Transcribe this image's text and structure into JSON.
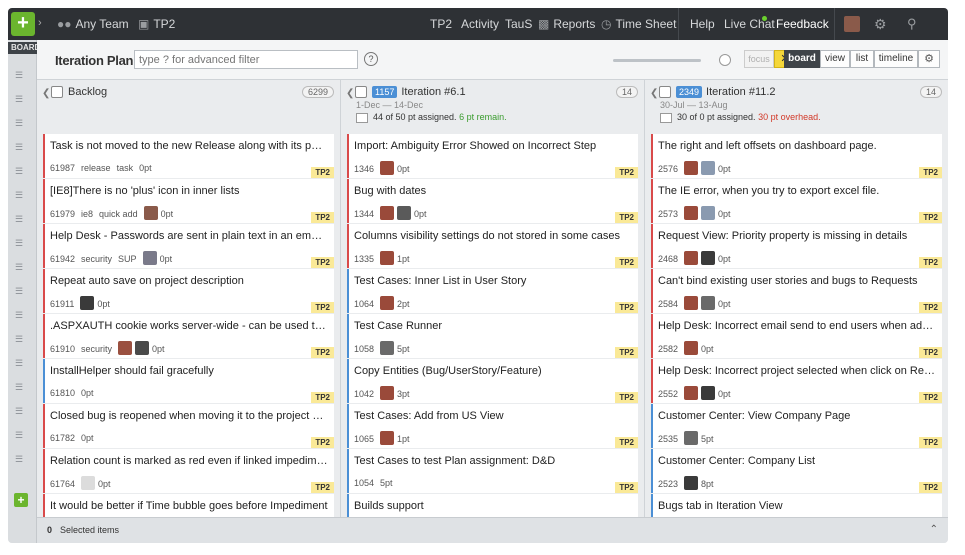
{
  "nav": {
    "team": "Any Team",
    "project": "TP2",
    "links": [
      "TP2",
      "Activity",
      "TauS",
      "Reports",
      "Time Sheet"
    ],
    "help": "Help",
    "live_chat": "Live Chat",
    "feedback": "Feedback"
  },
  "sidebar": {
    "board_label": "BOARD"
  },
  "toolbar": {
    "title": "Iteration Plan",
    "filter_placeholder": "type ? for advanced filter",
    "help": "?",
    "focus": "focus",
    "close": "✕",
    "views": [
      "board",
      "view",
      "list",
      "timeline"
    ]
  },
  "columns": [
    {
      "name": "Backlog",
      "count": "6299",
      "cards": [
        {
          "title": "Task is not moved to the new Release along with its parent User ...",
          "id": "61987",
          "tags": [
            "release",
            "task"
          ],
          "points": "0pt",
          "avatars": [],
          "type": "bug",
          "project": "TP2"
        },
        {
          "title": "[IE8]There is no 'plus' icon in inner lists",
          "id": "61979",
          "tags": [
            "ie8",
            "quick add"
          ],
          "points": "0pt",
          "avatars": [
            "#8a5a4a"
          ],
          "type": "bug",
          "project": "TP2"
        },
        {
          "title": "Help Desk - Passwords are sent in plain text in an email after pas...",
          "id": "61942",
          "tags": [
            "security",
            "SUP"
          ],
          "points": "0pt",
          "avatars": [
            "#7a7a8a"
          ],
          "type": "bug",
          "project": "TP2"
        },
        {
          "title": "Repeat auto save on project description",
          "id": "61911",
          "tags": [],
          "points": "0pt",
          "avatars": [
            "#3a3a3a"
          ],
          "type": "bug",
          "project": "TP2"
        },
        {
          "title": ".ASPXAUTH cookie works server-wide - can be used to access an...",
          "id": "61910",
          "tags": [
            "security"
          ],
          "points": "0pt",
          "avatars": [
            "#9a5040",
            "#4a4a4a"
          ],
          "type": "bug",
          "project": "TP2"
        },
        {
          "title": "InstallHelper should fail gracefully",
          "id": "61810",
          "tags": [],
          "points": "0pt",
          "avatars": [],
          "type": "story",
          "project": "TP2"
        },
        {
          "title": "Closed bug is reopened when moving it to the project with a diff...",
          "id": "61782",
          "tags": [],
          "points": "0pt",
          "avatars": [],
          "type": "bug",
          "project": "TP2"
        },
        {
          "title": "Relation count is marked as red even if linked impediment is clos...",
          "id": "61764",
          "tags": [],
          "points": "0pt",
          "avatars": [
            "#dcdcdc"
          ],
          "type": "bug",
          "project": "TP2"
        },
        {
          "title": "It would be better if Time bubble goes before Impediment",
          "id": "",
          "tags": [],
          "points": "",
          "avatars": [],
          "type": "bug",
          "project": ""
        }
      ]
    },
    {
      "name": "Iteration #6.1",
      "badge": "1157",
      "count": "14",
      "dates": "1-Dec — 14-Dec",
      "summary": "44 of 50 pt assigned.",
      "summary_status": "6 pt remain.",
      "status_kind": "ok",
      "cards": [
        {
          "title": "Import: Ambiguity Error Showed on Incorrect Step",
          "id": "1346",
          "tags": [],
          "points": "0pt",
          "avatars": [
            "#9a4a3a"
          ],
          "type": "bug",
          "project": "TP2"
        },
        {
          "title": "Bug with dates",
          "id": "1344",
          "tags": [],
          "points": "0pt",
          "avatars": [
            "#9a4a3a",
            "#5a5a5a"
          ],
          "type": "bug",
          "project": "TP2"
        },
        {
          "title": "Columns visibility settings do not stored in some cases",
          "id": "1335",
          "tags": [],
          "points": "1pt",
          "avatars": [
            "#9a4a3a"
          ],
          "type": "bug",
          "project": "TP2"
        },
        {
          "title": "Test Cases: Inner List in User Story",
          "id": "1064",
          "tags": [],
          "points": "2pt",
          "avatars": [
            "#9a4a3a"
          ],
          "type": "story",
          "project": "TP2"
        },
        {
          "title": "Test Case Runner",
          "id": "1058",
          "tags": [],
          "points": "5pt",
          "avatars": [
            "#6a6a6a"
          ],
          "type": "story",
          "project": "TP2"
        },
        {
          "title": "Copy Entities (Bug/UserStory/Feature)",
          "id": "1042",
          "tags": [],
          "points": "3pt",
          "avatars": [
            "#9a4a3a"
          ],
          "type": "story",
          "project": "TP2"
        },
        {
          "title": "Test Cases: Add from US View",
          "id": "1065",
          "tags": [],
          "points": "1pt",
          "avatars": [
            "#9a4a3a"
          ],
          "type": "story",
          "project": "TP2"
        },
        {
          "title": "Test Cases to test Plan assignment: D&D",
          "id": "1054",
          "tags": [],
          "points": "5pt",
          "avatars": [],
          "type": "story",
          "project": "TP2"
        },
        {
          "title": "Builds support",
          "id": "",
          "tags": [],
          "points": "",
          "avatars": [],
          "type": "story",
          "project": ""
        }
      ]
    },
    {
      "name": "Iteration #11.2",
      "badge": "2349",
      "count": "14",
      "dates": "30-Jul — 13-Aug",
      "summary": "30 of 0 pt assigned.",
      "summary_status": "30 pt overhead.",
      "status_kind": "bad",
      "cards": [
        {
          "title": "The right and left offsets on dashboard page.",
          "id": "2576",
          "tags": [],
          "points": "0pt",
          "avatars": [
            "#9a4a3a",
            "#8a9ab0"
          ],
          "type": "bug",
          "project": "TP2"
        },
        {
          "title": "The IE error, when you try to export excel file.",
          "id": "2573",
          "tags": [],
          "points": "0pt",
          "avatars": [
            "#9a4a3a",
            "#8a9ab0"
          ],
          "type": "bug",
          "project": "TP2"
        },
        {
          "title": "Request View: Priority property is missing in details",
          "id": "2468",
          "tags": [],
          "points": "0pt",
          "avatars": [
            "#9a4a3a",
            "#3a3a3a"
          ],
          "type": "bug",
          "project": "TP2"
        },
        {
          "title": "Can't bind existing user stories and bugs to Requests",
          "id": "2584",
          "tags": [],
          "points": "0pt",
          "avatars": [
            "#9a4a3a",
            "#6a6a6a"
          ],
          "type": "bug",
          "project": "TP2"
        },
        {
          "title": "Help Desk: Incorrect email send to end users when admin adds c...",
          "id": "2582",
          "tags": [],
          "points": "0pt",
          "avatars": [
            "#9a4a3a"
          ],
          "type": "bug",
          "project": "TP2"
        },
        {
          "title": "Help Desk: Incorrect project selected when click on Request nam...",
          "id": "2552",
          "tags": [],
          "points": "0pt",
          "avatars": [
            "#9a4a3a",
            "#3a3a3a"
          ],
          "type": "bug",
          "project": "TP2"
        },
        {
          "title": "Customer Center: View Company Page",
          "id": "2535",
          "tags": [],
          "points": "5pt",
          "avatars": [
            "#6a6a6a"
          ],
          "type": "story",
          "project": "TP2"
        },
        {
          "title": "Customer Center: Company List",
          "id": "2523",
          "tags": [],
          "points": "8pt",
          "avatars": [
            "#3a3a3a"
          ],
          "type": "story",
          "project": "TP2"
        },
        {
          "title": "Bugs tab in Iteration View",
          "id": "",
          "tags": [],
          "points": "",
          "avatars": [],
          "type": "story",
          "project": ""
        }
      ]
    }
  ],
  "footer": {
    "count": "0",
    "label": "Selected items"
  }
}
